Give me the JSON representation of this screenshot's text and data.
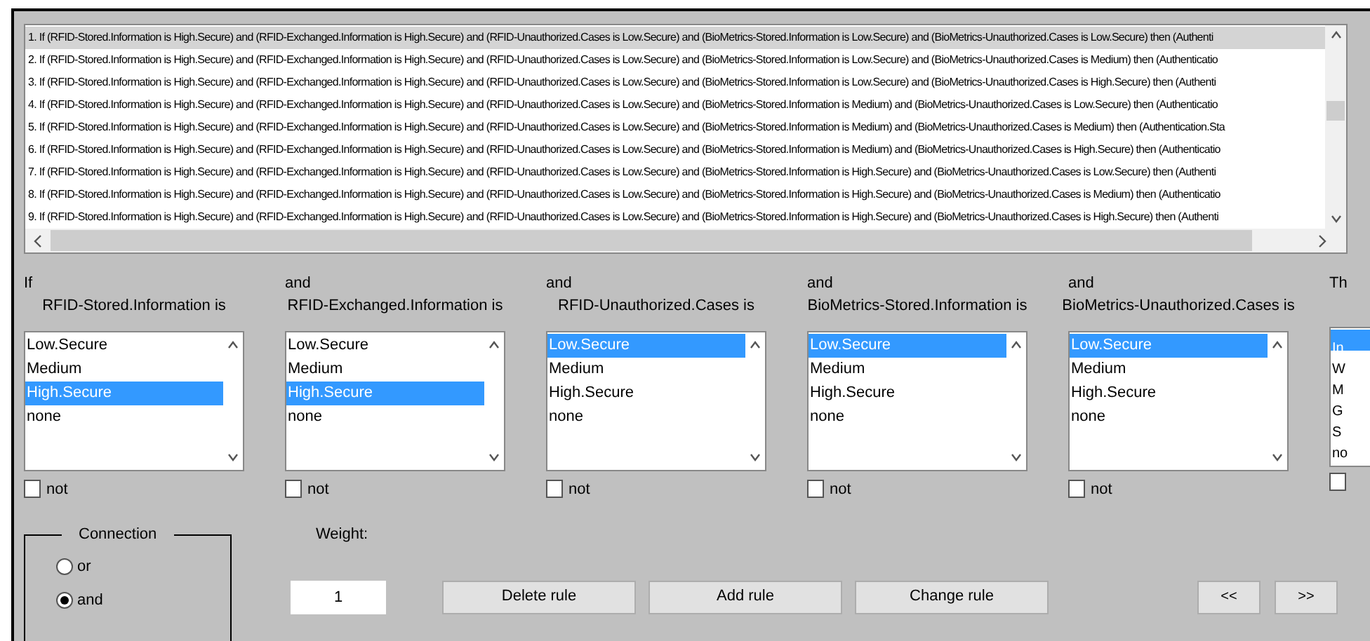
{
  "rules": [
    {
      "text": "1. If (RFID-Stored.Information is High.Secure) and (RFID-Exchanged.Information is High.Secure) and (RFID-Unauthorized.Cases is Low.Secure) and (BioMetrics-Stored.Information is Low.Secure) and (BioMetrics-Unauthorized.Cases is Low.Secure) then (Authenti",
      "selected": true
    },
    {
      "text": "2. If (RFID-Stored.Information is High.Secure) and (RFID-Exchanged.Information is High.Secure) and (RFID-Unauthorized.Cases is Low.Secure) and (BioMetrics-Stored.Information is Low.Secure) and (BioMetrics-Unauthorized.Cases is Medium) then (Authenticatio",
      "selected": false
    },
    {
      "text": "3. If (RFID-Stored.Information is High.Secure) and (RFID-Exchanged.Information is High.Secure) and (RFID-Unauthorized.Cases is Low.Secure) and (BioMetrics-Stored.Information is Low.Secure) and (BioMetrics-Unauthorized.Cases is High.Secure) then (Authenti",
      "selected": false
    },
    {
      "text": "4. If (RFID-Stored.Information is High.Secure) and (RFID-Exchanged.Information is High.Secure) and (RFID-Unauthorized.Cases is Low.Secure) and (BioMetrics-Stored.Information is Medium) and (BioMetrics-Unauthorized.Cases is Low.Secure) then (Authenticatio",
      "selected": false
    },
    {
      "text": "5. If (RFID-Stored.Information is High.Secure) and (RFID-Exchanged.Information is High.Secure) and (RFID-Unauthorized.Cases is Low.Secure) and (BioMetrics-Stored.Information is Medium) and (BioMetrics-Unauthorized.Cases is Medium) then (Authentication.Sta",
      "selected": false
    },
    {
      "text": "6. If (RFID-Stored.Information is High.Secure) and (RFID-Exchanged.Information is High.Secure) and (RFID-Unauthorized.Cases is Low.Secure) and (BioMetrics-Stored.Information is Medium) and (BioMetrics-Unauthorized.Cases is High.Secure) then (Authenticatio",
      "selected": false
    },
    {
      "text": "7. If (RFID-Stored.Information is High.Secure) and (RFID-Exchanged.Information is High.Secure) and (RFID-Unauthorized.Cases is Low.Secure) and (BioMetrics-Stored.Information is High.Secure) and (BioMetrics-Unauthorized.Cases is Low.Secure) then (Authenti",
      "selected": false
    },
    {
      "text": "8. If (RFID-Stored.Information is High.Secure) and (RFID-Exchanged.Information is High.Secure) and (RFID-Unauthorized.Cases is Low.Secure) and (BioMetrics-Stored.Information is High.Secure) and (BioMetrics-Unauthorized.Cases is Medium) then (Authenticatio",
      "selected": false
    },
    {
      "text": "9. If (RFID-Stored.Information is High.Secure) and (RFID-Exchanged.Information is High.Secure) and (RFID-Unauthorized.Cases is Low.Secure) and (BioMetrics-Stored.Information is High.Secure) and (BioMetrics-Unauthorized.Cases is High.Secure) then (Authenti",
      "selected": false
    }
  ],
  "antecedents": [
    {
      "connector": "If",
      "title": "RFID-Stored.Information is",
      "options": [
        {
          "label": "Low.Secure",
          "selected": false
        },
        {
          "label": "Medium",
          "selected": false
        },
        {
          "label": "High.Secure",
          "selected": true
        },
        {
          "label": "none",
          "selected": false
        }
      ],
      "not": {
        "label": "not",
        "checked": false
      }
    },
    {
      "connector": "and",
      "title": "RFID-Exchanged.Information is",
      "options": [
        {
          "label": "Low.Secure",
          "selected": false
        },
        {
          "label": "Medium",
          "selected": false
        },
        {
          "label": "High.Secure",
          "selected": true
        },
        {
          "label": "none",
          "selected": false
        }
      ],
      "not": {
        "label": "not",
        "checked": false
      }
    },
    {
      "connector": "and",
      "title": "RFID-Unauthorized.Cases is",
      "options": [
        {
          "label": "Low.Secure",
          "selected": true
        },
        {
          "label": "Medium",
          "selected": false
        },
        {
          "label": "High.Secure",
          "selected": false
        },
        {
          "label": "none",
          "selected": false
        }
      ],
      "not": {
        "label": "not",
        "checked": false
      }
    },
    {
      "connector": "and",
      "title": "BioMetrics-Stored.Information is",
      "options": [
        {
          "label": "Low.Secure",
          "selected": true
        },
        {
          "label": "Medium",
          "selected": false
        },
        {
          "label": "High.Secure",
          "selected": false
        },
        {
          "label": "none",
          "selected": false
        }
      ],
      "not": {
        "label": "not",
        "checked": false
      }
    },
    {
      "connector": "and",
      "title": "BioMetrics-Unauthorized.Cases is",
      "options": [
        {
          "label": "Low.Secure",
          "selected": true
        },
        {
          "label": "Medium",
          "selected": false
        },
        {
          "label": "High.Secure",
          "selected": false
        },
        {
          "label": "none",
          "selected": false
        }
      ],
      "not": {
        "label": "not",
        "checked": false
      }
    }
  ],
  "consequent": {
    "connector": "Th",
    "options": [
      {
        "label": "In",
        "selected": true
      },
      {
        "label": "W",
        "selected": false
      },
      {
        "label": "M",
        "selected": false
      },
      {
        "label": "G",
        "selected": false
      },
      {
        "label": "S",
        "selected": false
      },
      {
        "label": "no",
        "selected": false
      }
    ],
    "not_checked": false
  },
  "connection": {
    "title": "Connection",
    "options": [
      {
        "label": "or",
        "selected": false
      },
      {
        "label": "and",
        "selected": true
      }
    ]
  },
  "weight": {
    "label": "Weight:",
    "value": "1"
  },
  "buttons": [
    "Delete rule",
    "Add rule",
    "Change rule"
  ],
  "nav_buttons": [
    "<<",
    ">>"
  ]
}
